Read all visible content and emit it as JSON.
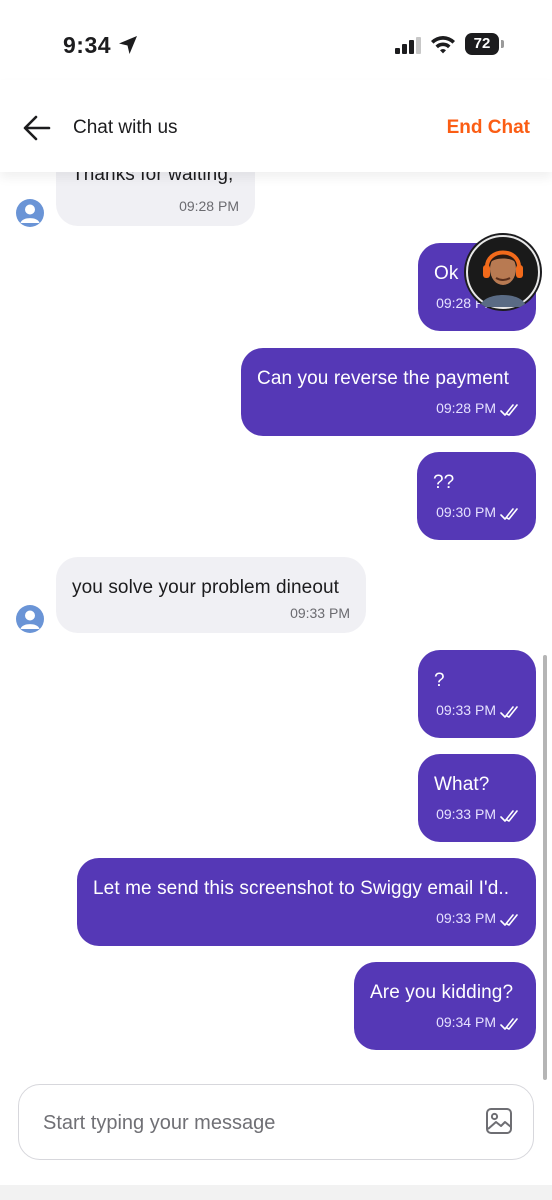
{
  "status_bar": {
    "time": "9:34",
    "battery": "72"
  },
  "header": {
    "title": "Chat with us",
    "end_chat": "End Chat"
  },
  "messages": [
    {
      "side": "in",
      "text": "Thanks for waiting,",
      "time": "09:28 PM"
    },
    {
      "side": "out",
      "text": "Ok",
      "time": "09:28 PM"
    },
    {
      "side": "out",
      "text": "Can you reverse the payment",
      "time": "09:28 PM"
    },
    {
      "side": "out",
      "text": "??",
      "time": "09:30 PM"
    },
    {
      "side": "in",
      "text": "you solve your problem dineout",
      "time": "09:33 PM"
    },
    {
      "side": "out",
      "text": "?",
      "time": "09:33 PM"
    },
    {
      "side": "out",
      "text": "What?",
      "time": "09:33 PM"
    },
    {
      "side": "out",
      "text": "Let me send this screenshot to Swiggy email I'd..",
      "time": "09:33 PM"
    },
    {
      "side": "out",
      "text": "Are you kidding?",
      "time": "09:34 PM"
    }
  ],
  "composer": {
    "placeholder": "Start typing your message"
  },
  "colors": {
    "outgoing_bubble": "#5538b6",
    "incoming_bubble": "#f0f0f4",
    "accent": "#fb5d14"
  },
  "icons": [
    "location-arrow-icon",
    "signal-icon",
    "wifi-icon",
    "battery-icon",
    "back-arrow-icon",
    "user-avatar-icon",
    "double-check-icon",
    "agent-avatar-icon",
    "image-attach-icon"
  ]
}
